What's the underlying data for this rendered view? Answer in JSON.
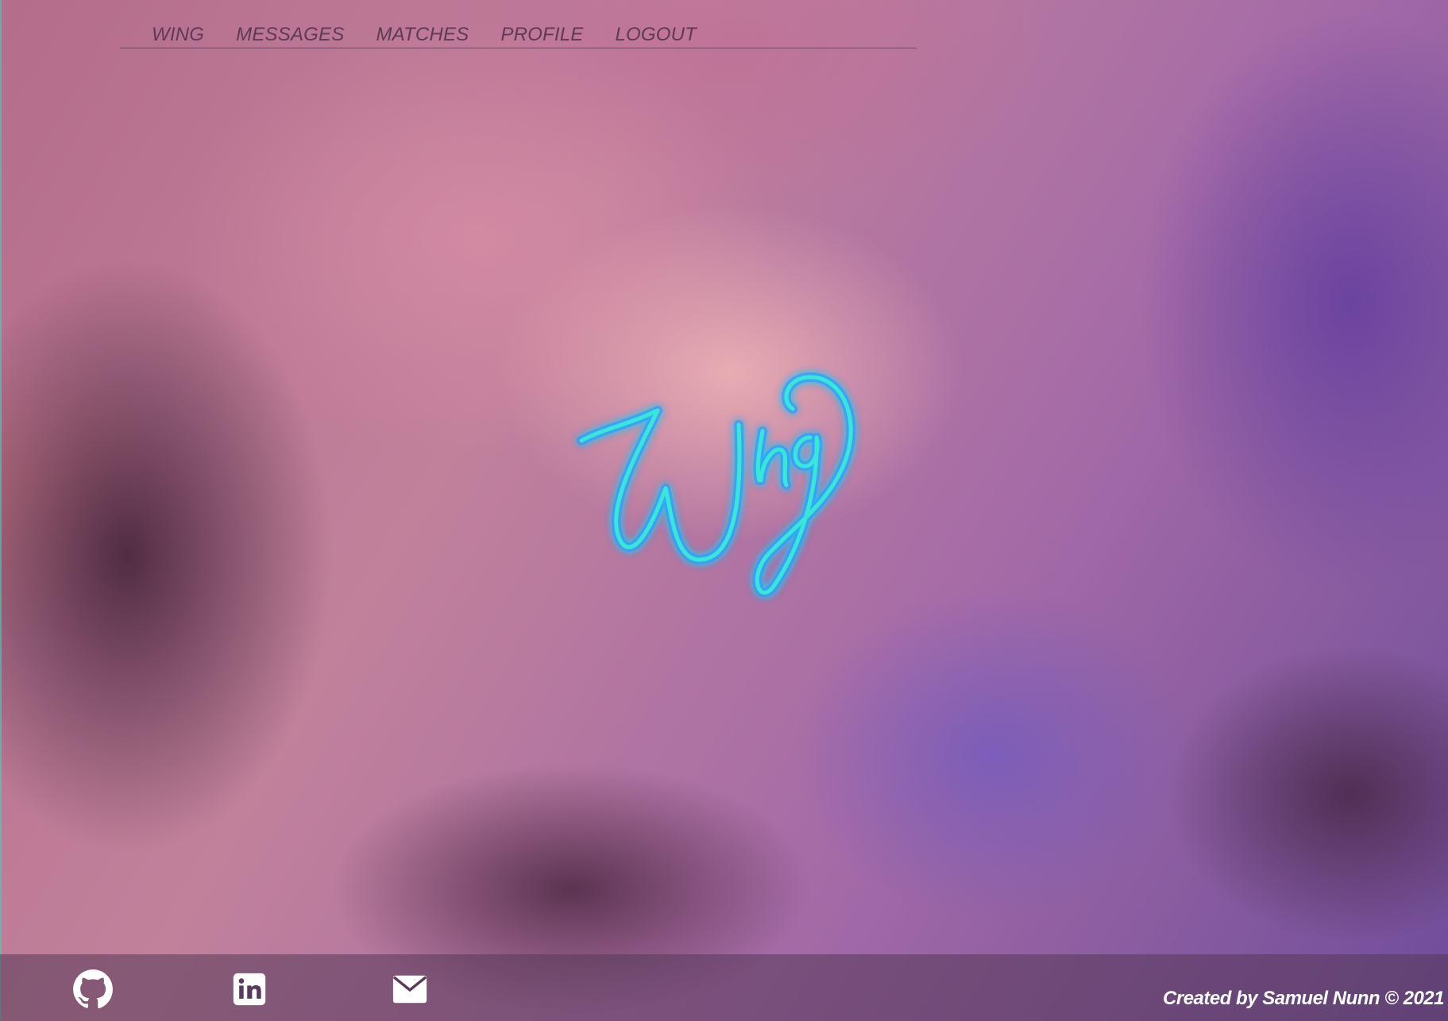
{
  "nav": {
    "items": [
      {
        "label": "WING"
      },
      {
        "label": "MESSAGES"
      },
      {
        "label": "MATCHES"
      },
      {
        "label": "PROFILE"
      },
      {
        "label": "LOGOUT"
      }
    ]
  },
  "hero": {
    "logo_text": "Wing",
    "logo_color": "#39e6dc",
    "logo_glow": "#2b8cff"
  },
  "footer": {
    "links": [
      {
        "icon": "github-icon"
      },
      {
        "icon": "linkedin-icon"
      },
      {
        "icon": "mail-icon"
      }
    ],
    "credit": "Created by Samuel Nunn © 2021"
  },
  "colors": {
    "nav_text": "#5e3a54",
    "footer_bg": "#563858",
    "credit_text": "#ffffff"
  }
}
